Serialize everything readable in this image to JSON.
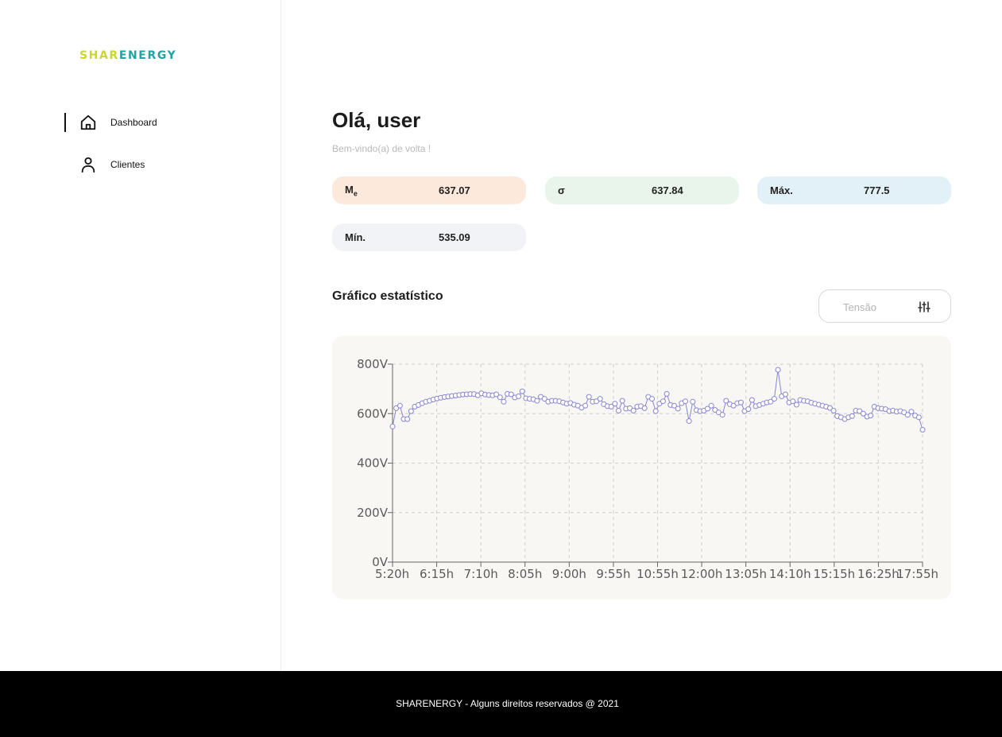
{
  "brand": {
    "part1": "SHAR",
    "part2": "ENERGY",
    "color1": "#c9d82a",
    "color2": "#20a4a4"
  },
  "nav": {
    "items": [
      {
        "label": "Dashboard",
        "icon": "home-icon",
        "active": true
      },
      {
        "label": "Clientes",
        "icon": "user-icon",
        "active": false
      }
    ]
  },
  "header": {
    "greeting": "Olá, user",
    "subtitle": "Bem-vindo(a) de volta !"
  },
  "stats": [
    {
      "key": "M",
      "key_sub": "e",
      "value": "637.07",
      "color": "#fde9dc"
    },
    {
      "key": "σ",
      "key_sub": "",
      "value": "637.84",
      "color": "#e9f5ea"
    },
    {
      "key": "Máx.",
      "key_sub": "",
      "value": "777.5",
      "color": "#e2f0f7"
    },
    {
      "key": "Mín.",
      "key_sub": "",
      "value": "535.09",
      "color": "#f2f3f6"
    }
  ],
  "chart_section": {
    "title": "Gráfico estatístico",
    "filter_placeholder": "Tensão",
    "filter_icon": "sliders-icon"
  },
  "chart_data": {
    "type": "line",
    "title": "",
    "xlabel": "",
    "ylabel": "",
    "ylim": [
      0,
      800
    ],
    "y_ticks": [
      "0V",
      "200V",
      "400V",
      "600V",
      "800V"
    ],
    "x_ticks": [
      "5:20h",
      "6:15h",
      "7:10h",
      "8:05h",
      "9:00h",
      "9:55h",
      "10:55h",
      "12:00h",
      "13:05h",
      "14:10h",
      "15:15h",
      "16:25h",
      "17:55h"
    ],
    "grid": true,
    "line_color": "#8884d8",
    "series": [
      {
        "values": [
          548,
          622,
          632,
          578,
          578,
          610,
          628,
          635,
          642,
          648,
          652,
          657,
          661,
          664,
          667,
          669,
          671,
          673,
          675,
          677,
          678,
          679,
          679,
          674,
          682,
          677,
          675,
          674,
          678,
          666,
          648,
          680,
          678,
          665,
          670,
          690,
          662,
          660,
          658,
          652,
          668,
          660,
          648,
          652,
          652,
          650,
          645,
          640,
          643,
          636,
          632,
          624,
          632,
          668,
          648,
          650,
          660,
          638,
          630,
          628,
          640,
          612,
          652,
          620,
          622,
          612,
          628,
          630,
          622,
          668,
          660,
          610,
          640,
          650,
          680,
          635,
          632,
          620,
          642,
          650,
          570,
          648,
          614,
          610,
          612,
          620,
          632,
          615,
          605,
          595,
          652,
          638,
          632,
          642,
          645,
          610,
          618,
          655,
          630,
          635,
          640,
          645,
          648,
          660,
          777,
          670,
          678,
          645,
          650,
          636,
          655,
          652,
          650,
          644,
          640,
          636,
          632,
          628,
          623,
          612,
          590,
          585,
          578,
          585,
          590,
          612,
          610,
          600,
          588,
          592,
          628,
          622,
          620,
          618,
          610,
          612,
          608,
          610,
          605,
          595,
          608,
          592,
          585,
          535
        ]
      }
    ]
  },
  "footer": {
    "text": "SHARENERGY - Alguns direitos reservados @ 2021"
  }
}
